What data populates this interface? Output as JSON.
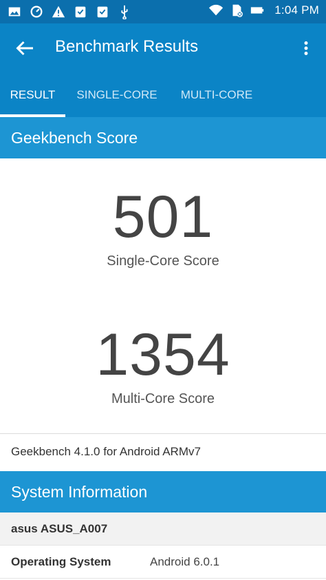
{
  "status_bar": {
    "time": "1:04 PM",
    "left_icons": [
      "image-icon",
      "sync-icon",
      "warning-icon",
      "clipboard-check-icon",
      "clipboard-check-icon",
      "usb-icon"
    ],
    "right_icons": [
      "wifi-icon",
      "no-sim-icon",
      "battery-icon"
    ]
  },
  "app_bar": {
    "title": "Benchmark Results"
  },
  "tabs": [
    {
      "label": "RESULT",
      "active": true
    },
    {
      "label": "SINGLE-CORE",
      "active": false
    },
    {
      "label": "MULTI-CORE",
      "active": false
    }
  ],
  "geekbench": {
    "header": "Geekbench Score",
    "single_score": "501",
    "single_label": "Single-Core Score",
    "multi_score": "1354",
    "multi_label": "Multi-Core Score",
    "version": "Geekbench 4.1.0 for Android ARMv7"
  },
  "system_info": {
    "header": "System Information",
    "device": "asus ASUS_A007",
    "rows": [
      {
        "key": "Operating System",
        "value": "Android 6.0.1"
      }
    ]
  },
  "colors": {
    "status_bar": "#0b6fad",
    "app_bar": "#0b84c6",
    "section_header": "#1d95d3"
  }
}
